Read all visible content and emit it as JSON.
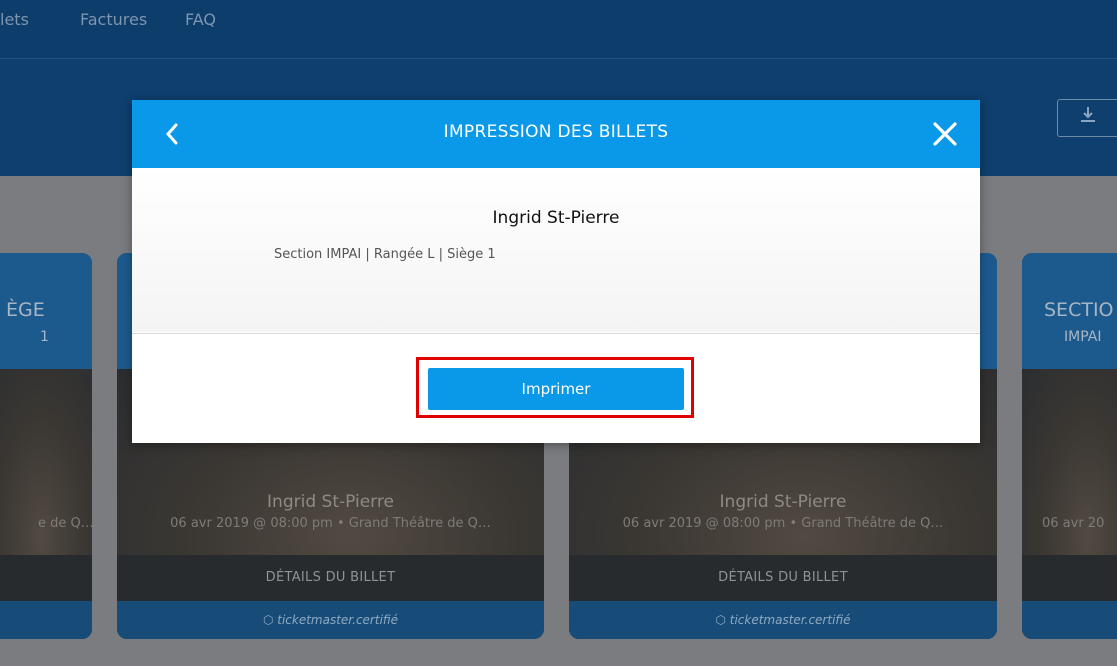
{
  "nav": {
    "items": [
      "lets",
      "Factures",
      "FAQ"
    ]
  },
  "download_icon": "download-icon",
  "cards": [
    {
      "title": "ÈGE",
      "subtitle": "1",
      "date": "e de Q…"
    },
    {
      "artist": "Ingrid St-Pierre",
      "date": "06 avr 2019 @ 08:00 pm • Grand Théâtre de Q…",
      "details": "DÉTAILS DU BILLET",
      "cert": "ticketmaster.certifié"
    },
    {
      "artist": "Ingrid St-Pierre",
      "date": "06 avr 2019 @ 08:00 pm • Grand Théâtre de Q…",
      "details": "DÉTAILS DU BILLET",
      "cert": "ticketmaster.certifié"
    },
    {
      "title": "SECTIO",
      "subtitle": "IMPAI",
      "date": "06 avr 20"
    }
  ],
  "modal": {
    "title": "IMPRESSION DES BILLETS",
    "ticket_name": "Ingrid St-Pierre",
    "ticket_seat": "Section IMPAI | Rangée L | Siège 1",
    "print_label": "Imprimer",
    "accent_color": "#0a98e8",
    "highlight_color": "#e10000"
  }
}
